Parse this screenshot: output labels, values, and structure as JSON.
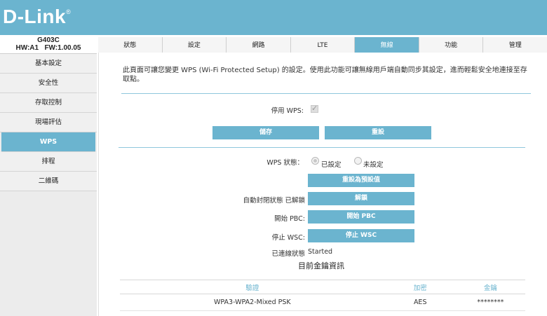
{
  "brand": {
    "logo": "D-Link",
    "registered": "®"
  },
  "device": {
    "model": "G403C",
    "hw": "HW:A1",
    "fw": "FW:1.00.05"
  },
  "sidebar": {
    "items": [
      {
        "label": "基本設定"
      },
      {
        "label": "安全性"
      },
      {
        "label": "存取控制"
      },
      {
        "label": "現場評估"
      },
      {
        "label": "WPS",
        "active": true
      },
      {
        "label": "排程"
      },
      {
        "label": "二維碼"
      }
    ]
  },
  "tabs": [
    {
      "label": "狀態"
    },
    {
      "label": "設定"
    },
    {
      "label": "網路"
    },
    {
      "label": "LTE"
    },
    {
      "label": "無線",
      "active": true
    },
    {
      "label": "功能"
    },
    {
      "label": "管理"
    }
  ],
  "main": {
    "description": "此頁面可讓您變更 WPS (Wi-Fi Protected Setup) 的設定。使用此功能可讓無線用戶端自動同步其設定，進而輕鬆安全地連接至存取點。",
    "enable_wps_label": "停用 WPS:",
    "enable_wps_checked": true,
    "save_button": "儲存",
    "reset_button": "重設",
    "wps_status_label": "WPS 狀態：",
    "status_configured": "已設定",
    "status_unconfigured": "未設定",
    "status_selected": "configured",
    "reset_default_button": "重設為預設值",
    "auto_lock_label": "自動封閉狀態 已解鎖",
    "unlock_button": "解鎖",
    "start_pbc_label": "開始 PBC:",
    "start_pbc_button": "開始 PBC",
    "stop_wsc_label": "停止 WSC:",
    "stop_wsc_button": "停止 WSC",
    "connection_status_label": "已連線狀態",
    "connection_status_value": "Started",
    "key_info_heading": "目前金鑰資訊",
    "key_table": {
      "headers": [
        "驗證",
        "加密",
        "金鑰"
      ],
      "rows": [
        [
          "WPA3-WPA2-Mixed PSK",
          "AES",
          "********"
        ]
      ]
    }
  },
  "colors": {
    "accent": "#6bb4cf",
    "header": "#6bb4cf"
  }
}
